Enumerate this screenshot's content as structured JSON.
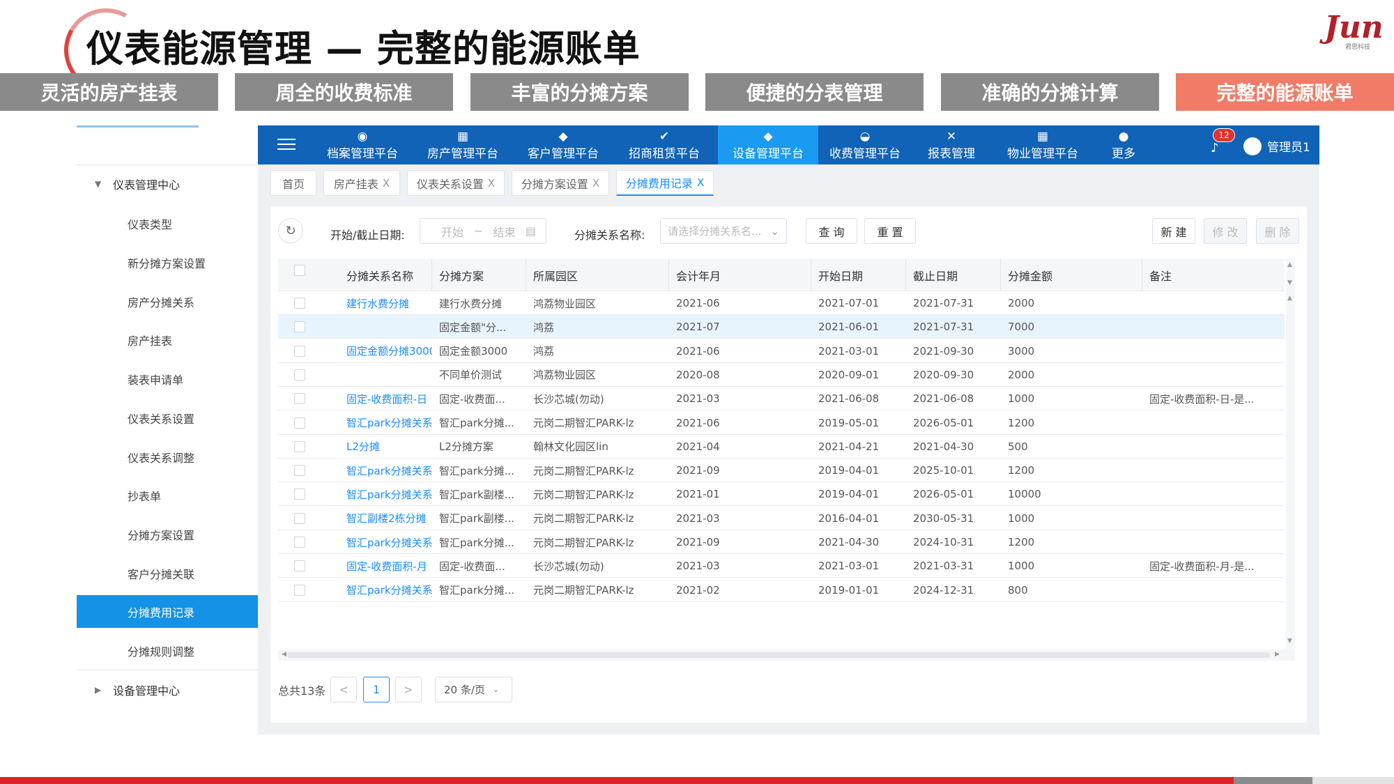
{
  "slide": {
    "title": "仪表能源管理 — 完整的能源账单",
    "logo_text": "Jun",
    "logo_sub": "君思科技",
    "feature_tabs": [
      {
        "label": "灵活的房产挂表"
      },
      {
        "label": "周全的收费标准"
      },
      {
        "label": "丰富的分摊方案"
      },
      {
        "label": "便捷的分表管理"
      },
      {
        "label": "准确的分摊计算"
      },
      {
        "label": "完整的能源账单",
        "active": true
      }
    ]
  },
  "sidebar": {
    "group1": "仪表管理中心",
    "items": [
      {
        "label": "仪表类型"
      },
      {
        "label": "新分摊方案设置"
      },
      {
        "label": "房产分摊关系"
      },
      {
        "label": "房产挂表"
      },
      {
        "label": "装表申请单"
      },
      {
        "label": "仪表关系设置"
      },
      {
        "label": "仪表关系调整"
      },
      {
        "label": "抄表单"
      },
      {
        "label": "分摊方案设置"
      },
      {
        "label": "客户分摊关联"
      },
      {
        "label": "分摊费用记录",
        "active": true
      },
      {
        "label": "分摊规则调整"
      }
    ],
    "group2": "设备管理中心"
  },
  "topnav": {
    "items": [
      {
        "label": "档案管理平台",
        "icon": "archive-icon"
      },
      {
        "label": "房产管理平台",
        "icon": "building-icon"
      },
      {
        "label": "客户管理平台",
        "icon": "handshake-icon"
      },
      {
        "label": "招商租赁平台",
        "icon": "check-icon"
      },
      {
        "label": "设备管理平台",
        "icon": "handshake-icon",
        "active": true
      },
      {
        "label": "收费管理平台",
        "icon": "coins-icon"
      },
      {
        "label": "报表管理",
        "icon": "tools-icon"
      },
      {
        "label": "物业管理平台",
        "icon": "building-icon"
      },
      {
        "label": "更多",
        "icon": "more-icon"
      }
    ],
    "badge": "12",
    "user": "管理员1"
  },
  "page_tabs": [
    {
      "label": "首页",
      "closable": false
    },
    {
      "label": "房产挂表",
      "closable": true
    },
    {
      "label": "仪表关系设置",
      "closable": true
    },
    {
      "label": "分摊方案设置",
      "closable": true
    },
    {
      "label": "分摊费用记录",
      "closable": true,
      "active": true
    }
  ],
  "close_glyph": "X",
  "toolbar": {
    "date_label": "开始/截止日期:",
    "date_start": "开始",
    "date_sep": "~",
    "date_end": "结束",
    "relation_label": "分摊关系名称:",
    "relation_placeholder": "请选择分摊关系名...",
    "query": "查 询",
    "reset": "重 置",
    "new": "新 建",
    "edit": "修 改",
    "delete": "删 除"
  },
  "table": {
    "columns": [
      "分摊关系名称",
      "分摊方案",
      "所属园区",
      "会计年月",
      "开始日期",
      "截止日期",
      "分摊金额",
      "备注"
    ],
    "rows": [
      [
        "建行水费分摊",
        "建行水费分摊",
        "鸿荔物业园区",
        "2021-06",
        "2021-07-01",
        "2021-07-31",
        "2000",
        ""
      ],
      [
        "",
        "固定金额\"分...",
        "鸿荔",
        "2021-07",
        "2021-06-01",
        "2021-07-31",
        "7000",
        ""
      ],
      [
        "固定金额分摊3000",
        "固定金额3000",
        "鸿荔",
        "2021-06",
        "2021-03-01",
        "2021-09-30",
        "3000",
        ""
      ],
      [
        "",
        "不同单价测试",
        "鸿荔物业园区",
        "2020-08",
        "2020-09-01",
        "2020-09-30",
        "2000",
        ""
      ],
      [
        "固定-收费面积-日",
        "固定-收费面...",
        "长沙芯城(勿动)",
        "2021-03",
        "2021-06-08",
        "2021-06-08",
        "1000",
        "固定-收费面积-日-是..."
      ],
      [
        "智汇park分摊关系",
        "智汇park分摊...",
        "元岗二期智汇PARK-lz",
        "2021-06",
        "2019-05-01",
        "2026-05-01",
        "1200",
        ""
      ],
      [
        "L2分摊",
        "L2分摊方案",
        "翰林文化园区lin",
        "2021-04",
        "2021-04-21",
        "2021-04-30",
        "500",
        ""
      ],
      [
        "智汇park分摊关系",
        "智汇park分摊...",
        "元岗二期智汇PARK-lz",
        "2021-09",
        "2019-04-01",
        "2025-10-01",
        "1200",
        ""
      ],
      [
        "智汇park分摊关系",
        "智汇park副楼...",
        "元岗二期智汇PARK-lz",
        "2021-01",
        "2019-04-01",
        "2026-05-01",
        "10000",
        ""
      ],
      [
        "智汇副楼2栋分摊",
        "智汇park副楼...",
        "元岗二期智汇PARK-lz",
        "2021-03",
        "2016-04-01",
        "2030-05-31",
        "1000",
        ""
      ],
      [
        "智汇park分摊关系",
        "智汇park分摊...",
        "元岗二期智汇PARK-lz",
        "2021-09",
        "2021-04-30",
        "2024-10-31",
        "1200",
        ""
      ],
      [
        "固定-收费面积-月",
        "固定-收费面...",
        "长沙芯城(勿动)",
        "2021-03",
        "2021-03-01",
        "2021-03-31",
        "1000",
        "固定-收费面积-月-是..."
      ],
      [
        "智汇park分摊关系",
        "智汇park分摊...",
        "元岗二期智汇PARK-lz",
        "2021-02",
        "2019-01-01",
        "2024-12-31",
        "800",
        ""
      ]
    ],
    "highlighted_row": 1
  },
  "pagination": {
    "total": "总共13条",
    "prev": "<",
    "current": "1",
    "next": ">",
    "page_size": "20 条/页"
  },
  "colors": {
    "nav_bg": "#1063b6",
    "nav_active": "#1a9af0",
    "accent": "#1a8cff",
    "feature_active": "#f07c67",
    "feature_bg": "#8a8a8a",
    "brand_red": "#d9242a"
  }
}
